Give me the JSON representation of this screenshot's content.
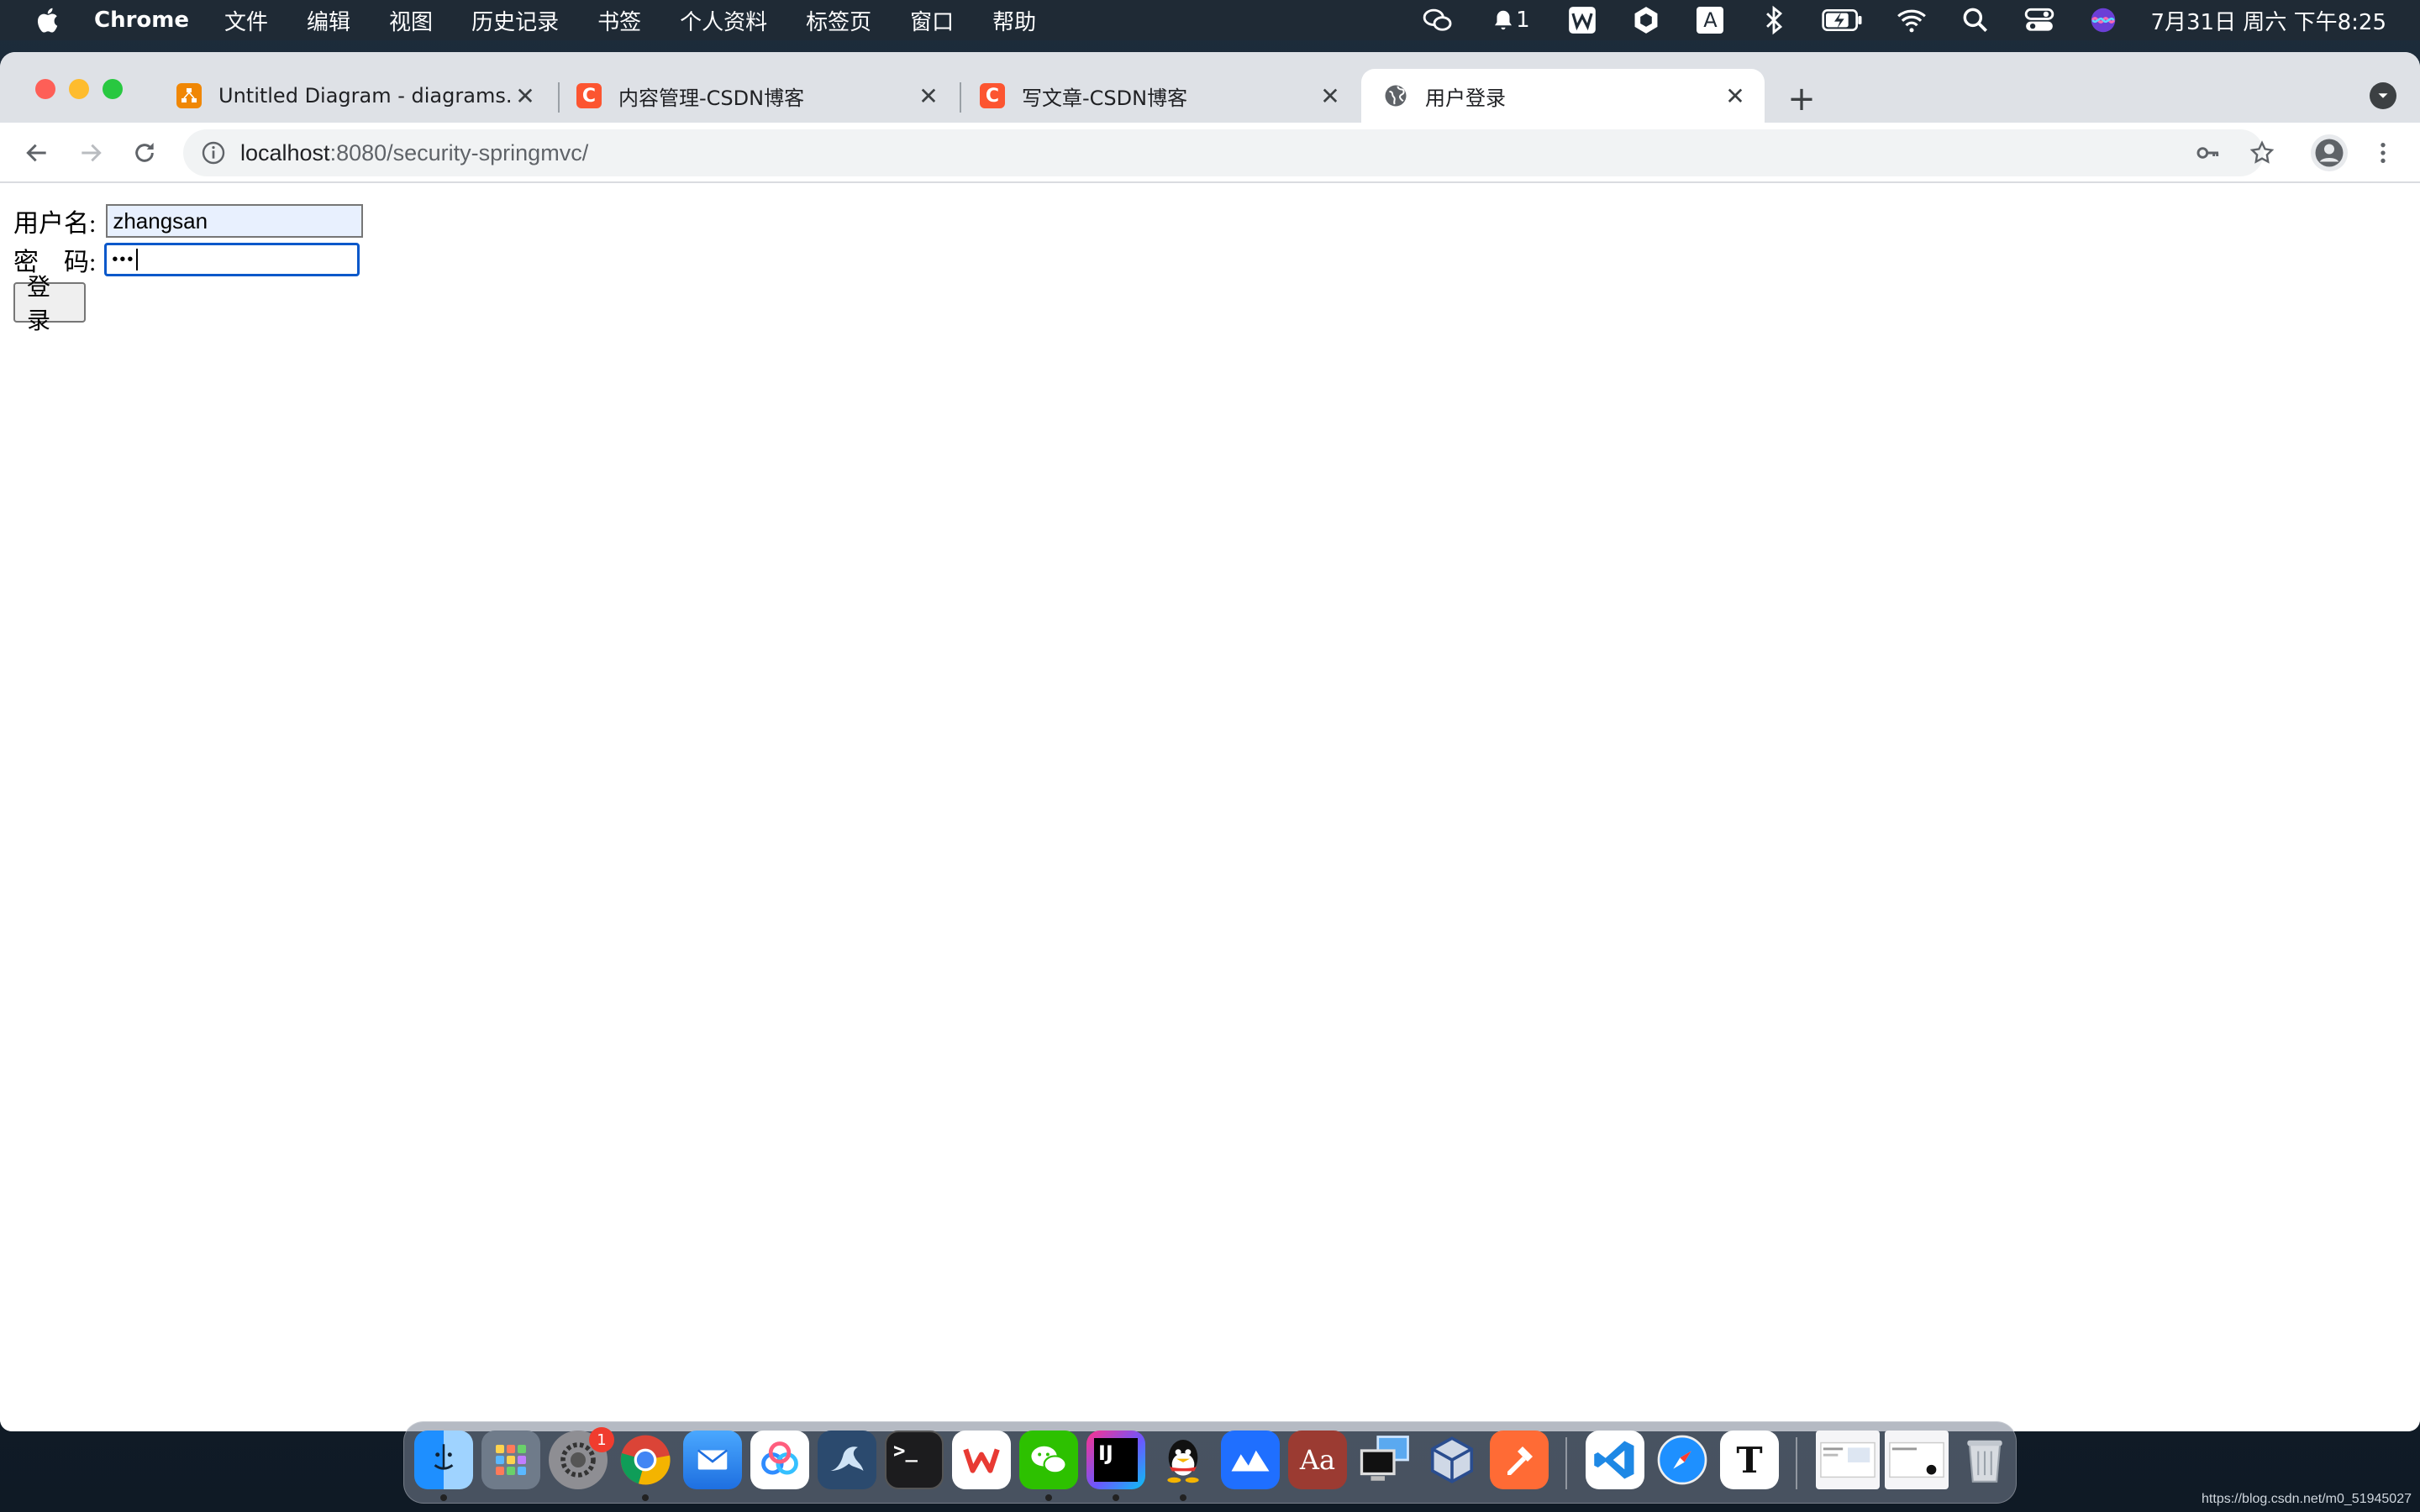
{
  "menubar": {
    "app_name": "Chrome",
    "items": [
      "文件",
      "编辑",
      "视图",
      "历史记录",
      "书签",
      "个人资料",
      "标签页",
      "窗口",
      "帮助"
    ],
    "notification_count": "1",
    "input_source": "A",
    "clock": "7月31日 周六 下午8:25"
  },
  "tabs": [
    {
      "title": "Untitled Diagram - diagrams.net",
      "favicon": "diagrams-icon",
      "active": false
    },
    {
      "title": "内容管理-CSDN博客",
      "favicon": "csdn-icon",
      "active": false
    },
    {
      "title": "写文章-CSDN博客",
      "favicon": "csdn-icon",
      "active": false
    },
    {
      "title": "用户登录",
      "favicon": "globe-icon",
      "active": true
    }
  ],
  "address": {
    "host": "localhost",
    "rest": ":8080/security-springmvc/"
  },
  "form": {
    "username_label": "用户名:",
    "username_value": "zhangsan",
    "password_label": "密　码:",
    "password_value": "•••",
    "submit_label": "登录"
  },
  "dock": {
    "settings_badge": "1",
    "intellij_label": "IJ",
    "dictionary_label": "Aa",
    "typora_label": "T"
  },
  "watermark": "https://blog.csdn.net/m0_51945027",
  "colors": {
    "csdn": "#fc5531",
    "drawio": "#f08705",
    "focus": "#0a58ca"
  }
}
